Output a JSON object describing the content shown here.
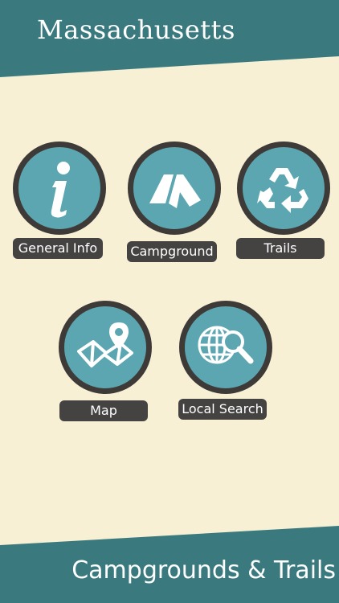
{
  "header": {
    "title": "Massachusetts"
  },
  "footer": {
    "title": "Campgrounds & Trails"
  },
  "colors": {
    "teal_dark": "#3a7a7f",
    "teal_circle": "#5ba6b1",
    "ring": "#3d3a38",
    "label_bg": "#454242",
    "background": "#f7f0d5"
  },
  "menu": {
    "general_info": {
      "label": "General Info",
      "icon": "info-icon"
    },
    "campground": {
      "label": "Campground",
      "icon": "tent-icon"
    },
    "trails": {
      "label": "Trails",
      "icon": "recycle-icon"
    },
    "map": {
      "label": "Map",
      "icon": "map-pin-icon"
    },
    "local_search": {
      "label": "Local Search",
      "icon": "globe-search-icon"
    }
  }
}
